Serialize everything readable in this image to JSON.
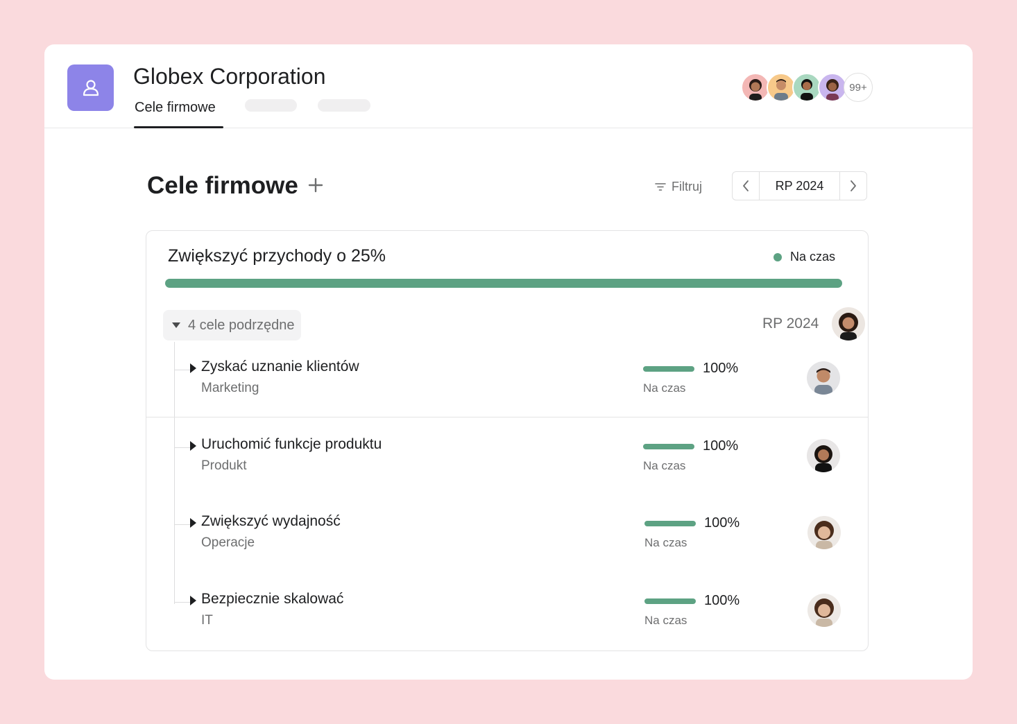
{
  "header": {
    "org_title": "Globex Corporation",
    "active_tab": "Cele firmowe",
    "team_icon": "team-icon",
    "member_overflow": "99+"
  },
  "toolbar": {
    "page_title": "Cele firmowe",
    "add_icon": "plus-icon",
    "filter_label": "Filtruj",
    "filter_icon": "filter-icon",
    "period_label": "RP 2024"
  },
  "goal": {
    "title": "Zwiększyć przychody o 25%",
    "status": "Na czas",
    "status_color": "#5da283",
    "progress": 1.0,
    "subgoals_label": "4 cele podrzędne",
    "period": "RP 2024",
    "subgoals": [
      {
        "title": "Zyskać uznanie klientów",
        "team": "Marketing",
        "percent": "100%",
        "progress": 1.0,
        "status": "Na czas"
      },
      {
        "title": "Uruchomić funkcje produktu",
        "team": "Produkt",
        "percent": "100%",
        "progress": 1.0,
        "status": "Na czas"
      },
      {
        "title": "Zwiększyć wydajność",
        "team": "Operacje",
        "percent": "100%",
        "progress": 1.0,
        "status": "Na czas"
      },
      {
        "title": "Bezpiecznie skalować",
        "team": "IT",
        "percent": "100%",
        "progress": 1.0,
        "status": "Na czas"
      }
    ]
  },
  "colors": {
    "background": "#fadadd",
    "accent": "#8d84e8",
    "on_track": "#5da283"
  }
}
